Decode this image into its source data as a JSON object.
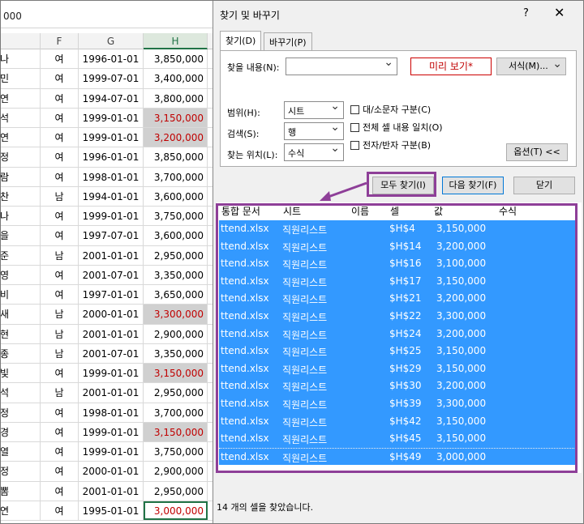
{
  "sheet": {
    "formula_bar": "000",
    "columns": [
      "F",
      "G",
      "H"
    ],
    "rows": [
      {
        "e": "나",
        "f": "여",
        "g": "1996-01-01",
        "h": "3,850,000",
        "style": ""
      },
      {
        "e": "민",
        "f": "여",
        "g": "1999-07-01",
        "h": "3,400,000",
        "style": ""
      },
      {
        "e": "연",
        "f": "여",
        "g": "1994-07-01",
        "h": "3,800,000",
        "style": ""
      },
      {
        "e": "석",
        "f": "여",
        "g": "1999-01-01",
        "h": "3,150,000",
        "style": "hl"
      },
      {
        "e": "연",
        "f": "여",
        "g": "1999-01-01",
        "h": "3,200,000",
        "style": "hl"
      },
      {
        "e": "정",
        "f": "여",
        "g": "1996-01-01",
        "h": "3,850,000",
        "style": ""
      },
      {
        "e": "람",
        "f": "여",
        "g": "1998-01-01",
        "h": "3,700,000",
        "style": ""
      },
      {
        "e": "찬",
        "f": "남",
        "g": "1994-01-01",
        "h": "3,600,000",
        "style": ""
      },
      {
        "e": "나",
        "f": "여",
        "g": "1999-01-01",
        "h": "3,750,000",
        "style": ""
      },
      {
        "e": "을",
        "f": "여",
        "g": "1997-07-01",
        "h": "3,600,000",
        "style": ""
      },
      {
        "e": "준",
        "f": "남",
        "g": "2001-01-01",
        "h": "2,950,000",
        "style": ""
      },
      {
        "e": "영",
        "f": "여",
        "g": "2001-07-01",
        "h": "3,350,000",
        "style": ""
      },
      {
        "e": "비",
        "f": "여",
        "g": "1997-01-01",
        "h": "3,650,000",
        "style": ""
      },
      {
        "e": "새",
        "f": "남",
        "g": "2000-01-01",
        "h": "3,300,000",
        "style": "hl"
      },
      {
        "e": "현",
        "f": "남",
        "g": "2001-01-01",
        "h": "2,900,000",
        "style": ""
      },
      {
        "e": "종",
        "f": "남",
        "g": "2001-07-01",
        "h": "3,350,000",
        "style": ""
      },
      {
        "e": "빛",
        "f": "여",
        "g": "1999-01-01",
        "h": "3,150,000",
        "style": "hl"
      },
      {
        "e": "석",
        "f": "남",
        "g": "2001-01-01",
        "h": "2,950,000",
        "style": ""
      },
      {
        "e": "정",
        "f": "여",
        "g": "1998-01-01",
        "h": "3,700,000",
        "style": ""
      },
      {
        "e": "경",
        "f": "여",
        "g": "1999-01-01",
        "h": "3,150,000",
        "style": "hl"
      },
      {
        "e": "열",
        "f": "여",
        "g": "1999-01-01",
        "h": "3,750,000",
        "style": ""
      },
      {
        "e": "정",
        "f": "여",
        "g": "2000-01-01",
        "h": "2,900,000",
        "style": ""
      },
      {
        "e": "뽐",
        "f": "여",
        "g": "2001-01-01",
        "h": "2,950,000",
        "style": ""
      },
      {
        "e": "연",
        "f": "여",
        "g": "1995-01-01",
        "h": "3,000,000",
        "style": "active"
      }
    ]
  },
  "dialog": {
    "title": "찾기 및 바꾸기",
    "help": "?",
    "close": "✕",
    "tabs": {
      "find": "찾기(D)",
      "replace": "바꾸기(P)"
    },
    "find_label": "찾을 내용(N):",
    "find_value": "",
    "preview": "미리 보기*",
    "format_btn": "서식(M)...",
    "scope_label": "범위(H):",
    "scope_value": "시트",
    "search_label": "검색(S):",
    "search_value": "행",
    "lookin_label": "찾는 위치(L):",
    "lookin_value": "수식",
    "match_case": "대/소문자 구분(C)",
    "match_entire": "전체 셀 내용 일치(O)",
    "match_byte": "전자/반자 구분(B)",
    "options_btn": "옵션(T) <<",
    "find_all_btn": "모두 찾기(I)",
    "find_next_btn": "다음 찾기(F)",
    "close_btn": "닫기",
    "result_headers": [
      "통합 문서",
      "시트",
      "이름",
      "셀",
      "값",
      "수식"
    ],
    "results": [
      {
        "book": "ttend.xlsx",
        "sheet": "직원리스트",
        "cell": "$H$4",
        "value": "3,150,000"
      },
      {
        "book": "ttend.xlsx",
        "sheet": "직원리스트",
        "cell": "$H$14",
        "value": "3,200,000"
      },
      {
        "book": "ttend.xlsx",
        "sheet": "직원리스트",
        "cell": "$H$16",
        "value": "3,100,000"
      },
      {
        "book": "ttend.xlsx",
        "sheet": "직원리스트",
        "cell": "$H$17",
        "value": "3,150,000"
      },
      {
        "book": "ttend.xlsx",
        "sheet": "직원리스트",
        "cell": "$H$21",
        "value": "3,200,000"
      },
      {
        "book": "ttend.xlsx",
        "sheet": "직원리스트",
        "cell": "$H$22",
        "value": "3,300,000"
      },
      {
        "book": "ttend.xlsx",
        "sheet": "직원리스트",
        "cell": "$H$24",
        "value": "3,200,000"
      },
      {
        "book": "ttend.xlsx",
        "sheet": "직원리스트",
        "cell": "$H$25",
        "value": "3,150,000"
      },
      {
        "book": "ttend.xlsx",
        "sheet": "직원리스트",
        "cell": "$H$29",
        "value": "3,150,000"
      },
      {
        "book": "ttend.xlsx",
        "sheet": "직원리스트",
        "cell": "$H$30",
        "value": "3,200,000"
      },
      {
        "book": "ttend.xlsx",
        "sheet": "직원리스트",
        "cell": "$H$39",
        "value": "3,300,000"
      },
      {
        "book": "ttend.xlsx",
        "sheet": "직원리스트",
        "cell": "$H$42",
        "value": "3,150,000"
      },
      {
        "book": "ttend.xlsx",
        "sheet": "직원리스트",
        "cell": "$H$45",
        "value": "3,150,000"
      },
      {
        "book": "ttend.xlsx",
        "sheet": "직원리스트",
        "cell": "$H$49",
        "value": "3,000,000"
      }
    ],
    "status": "14 개의 셀을 찾았습니다."
  },
  "colors": {
    "selection": "#3399ff",
    "annotation": "#8e3f98",
    "red_text": "#c00000"
  }
}
